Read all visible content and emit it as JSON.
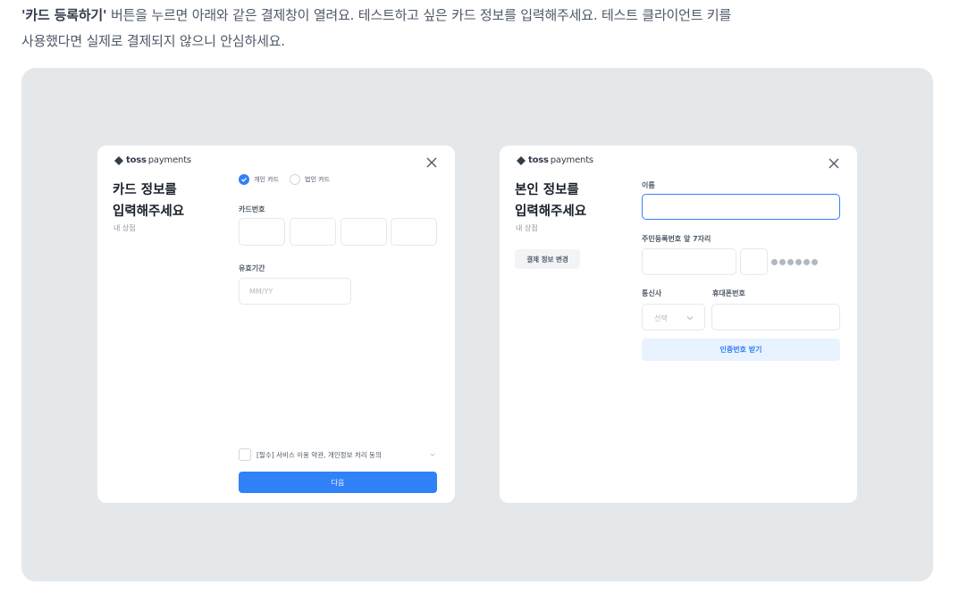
{
  "intro": {
    "bold": "'카드 등록하기'",
    "line1": " 버튼을 누르면 아래와 같은 결제창이 열려요. 테스트하고 싶은 카드 정보를 입력해주세요. 테스트 클라이언트 키를",
    "line2": "사용했다면 실제로 결제되지 않으니 안심하세요."
  },
  "brand": {
    "name": "toss",
    "suffix": "payments"
  },
  "card_form": {
    "title_line1": "카드 정보를",
    "title_line2": "입력해주세요",
    "store": "내 상점",
    "radio_personal": "개인 카드",
    "radio_corporate": "법인 카드",
    "card_number_label": "카드번호",
    "expiry_label": "유효기간",
    "expiry_placeholder": "MM/YY",
    "agree_text": "[필수] 서비스 이용 약관, 개인정보 처리 동의",
    "next_button": "다음"
  },
  "identity_form": {
    "title_line1": "본인 정보를",
    "title_line2": "입력해주세요",
    "store": "내 상점",
    "change_button": "결제 정보 변경",
    "name_label": "이름",
    "rrn_label": "주민등록번호 앞 7자리",
    "carrier_label": "통신사",
    "carrier_value": "선택",
    "phone_label": "휴대폰번호",
    "verify_button": "인증번호 받기"
  },
  "colors": {
    "primary": "#3182f6",
    "panel_bg": "#e5e8eb",
    "light_blue": "#e8f3ff"
  }
}
